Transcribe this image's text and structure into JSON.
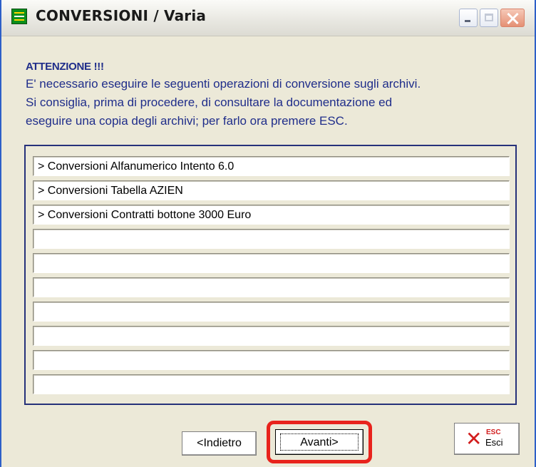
{
  "window": {
    "title": "CONVERSIONI / Varia"
  },
  "notice": {
    "heading": "ATTENZIONE !!!",
    "line1": "E' necessario eseguire le seguenti operazioni di conversione sugli archivi.",
    "line2": "Si consiglia, prima di procedere, di  consultare la documentazione ed",
    "line3": "eseguire una copia degli archivi; per farlo ora premere ESC."
  },
  "conversions": {
    "items": [
      "> Conversioni Alfanumerico Intento 6.0",
      "> Conversioni Tabella AZIEN",
      "> Conversioni Contratti bottone 3000 Euro",
      "",
      "",
      "",
      "",
      "",
      "",
      ""
    ]
  },
  "buttons": {
    "back_label": "<Indietro",
    "next_label": "Avanti>",
    "exit_sup": "ESC",
    "exit_label": "Esci"
  },
  "colors": {
    "notice_text": "#1f2d8a",
    "highlight": "#e8231c",
    "window_bg": "#ece9d8"
  }
}
